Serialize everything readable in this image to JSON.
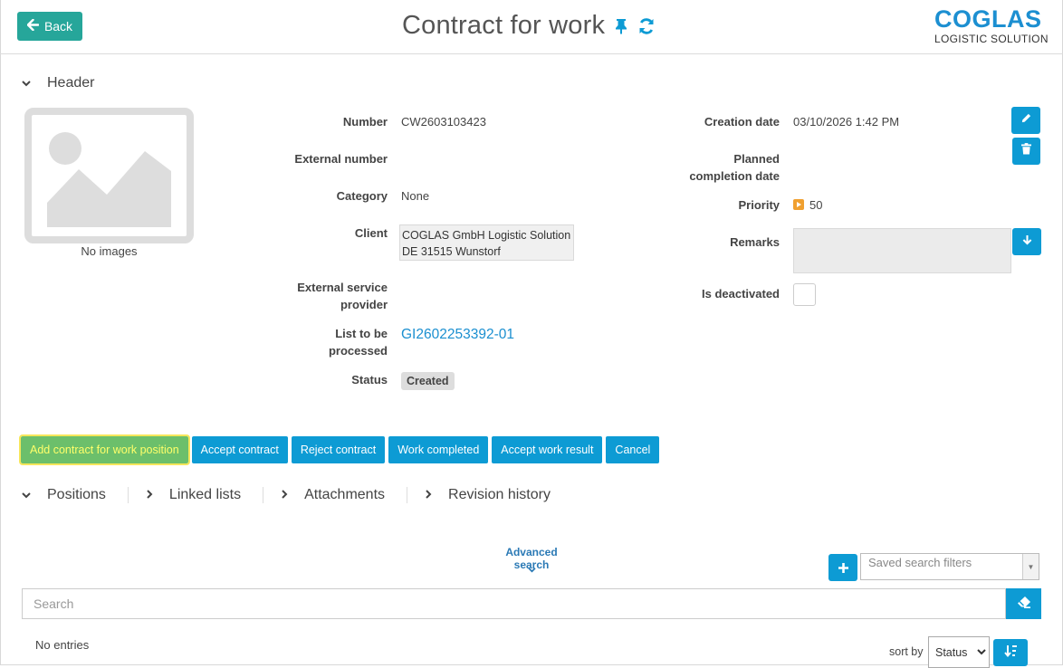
{
  "topbar": {
    "back_label": "Back",
    "title": "Contract for work",
    "logo_main": "COGLAS",
    "logo_sub": "LOGISTIC SOLUTION"
  },
  "header_section": {
    "label": "Header",
    "no_images": "No images"
  },
  "fields": {
    "number_label": "Number",
    "number_value": "CW2603103423",
    "external_number_label": "External number",
    "category_label": "Category",
    "category_value": "None",
    "client_label": "Client",
    "client_line1": "COGLAS GmbH Logistic Solution",
    "client_line2": "DE 31515 Wunstorf",
    "esp_label_1": "External service",
    "esp_label_2": "provider",
    "list_label_1": "List to be",
    "list_label_2": "processed",
    "list_value": "GI2602253392-01",
    "status_label": "Status",
    "status_value": "Created",
    "creation_date_label": "Creation date",
    "creation_date_value": "03/10/2026 1:42 PM",
    "planned_label_1": "Planned",
    "planned_label_2": "completion date",
    "priority_label": "Priority",
    "priority_value": "50",
    "remarks_label": "Remarks",
    "deactivated_label": "Is deactivated"
  },
  "actions": [
    "Add contract for work position",
    "Accept contract",
    "Reject contract",
    "Work completed",
    "Accept work result",
    "Cancel"
  ],
  "tabs": [
    "Positions",
    "Linked lists",
    "Attachments",
    "Revision history"
  ],
  "search": {
    "advanced_label": "Advanced search",
    "saved_filters_placeholder": "Saved search filters",
    "placeholder": "Search",
    "no_entries": "No entries",
    "sort_label": "sort by",
    "sort_value": "Status"
  },
  "colors": {
    "accent": "#0d9bd4",
    "back_button": "#26a69a",
    "primary_action": "#6cbf6b",
    "logo": "#1c8fd1"
  }
}
